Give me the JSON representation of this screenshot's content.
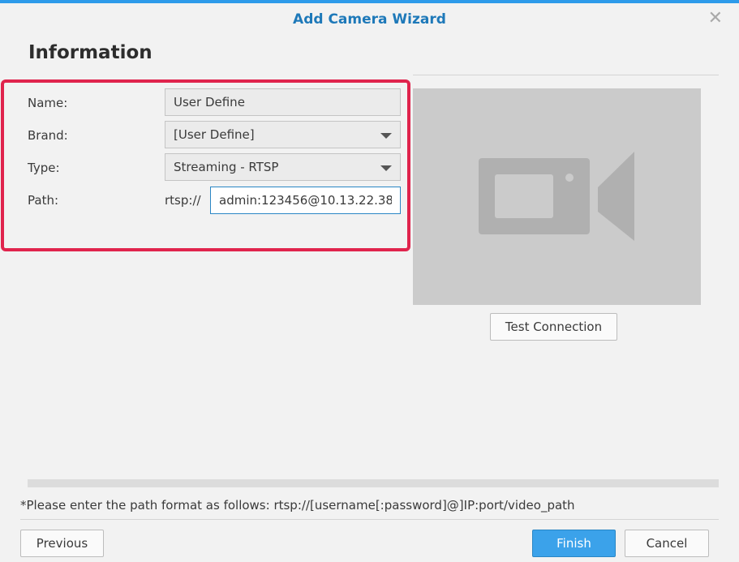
{
  "window": {
    "title": "Add Camera Wizard",
    "close_icon": "close-icon"
  },
  "section": {
    "title": "Information"
  },
  "form": {
    "name_label": "Name:",
    "name_value": "User Define",
    "brand_label": "Brand:",
    "brand_value": "[User Define]",
    "type_label": "Type:",
    "type_value": "Streaming - RTSP",
    "path_label": "Path:",
    "path_prefix": "rtsp://",
    "path_value": "admin:123456@10.13.22.38"
  },
  "preview": {
    "icon": "video-camera-icon",
    "test_button": "Test Connection"
  },
  "hint": "*Please enter the path format as follows: rtsp://[username[:password]@]IP:port/video_path",
  "footer": {
    "previous": "Previous",
    "finish": "Finish",
    "cancel": "Cancel"
  },
  "colors": {
    "accent": "#2d9bea",
    "title": "#1e79b9",
    "highlight": "#e0244d",
    "primary_button": "#3ba2ea",
    "preview_bg": "#cbcbcb"
  }
}
